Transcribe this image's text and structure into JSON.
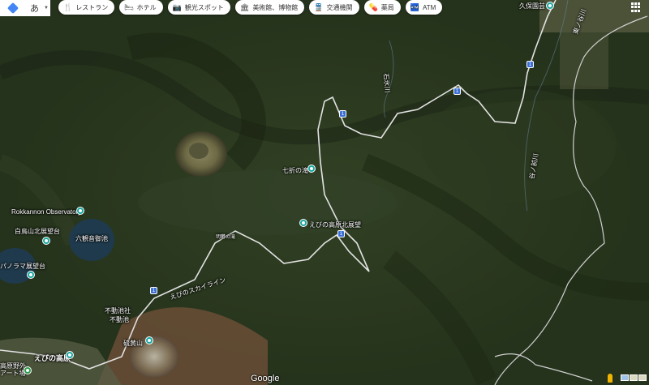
{
  "colors": {
    "terrain_dark": "#1f2a18",
    "forest": "#2e3d22",
    "lake": "#1f3a4c",
    "road": "#e8e8e8",
    "pin": "#1aa7a0",
    "route_shield": "#3b6fd6",
    "accent_blue": "#4285f4"
  },
  "topbar": {
    "language": "あ",
    "chips": [
      {
        "icon": "fork-knife-icon",
        "glyph": "🍴",
        "label": "レストラン"
      },
      {
        "icon": "bed-icon",
        "glyph": "🛏",
        "label": "ホテル"
      },
      {
        "icon": "camera-icon",
        "glyph": "📷",
        "label": "観光スポット"
      },
      {
        "icon": "museum-icon",
        "glyph": "🏛",
        "label": "美術館、博物館"
      },
      {
        "icon": "train-icon",
        "glyph": "🚆",
        "label": "交通機関"
      },
      {
        "icon": "pharmacy-icon",
        "glyph": "💊",
        "label": "薬局"
      },
      {
        "icon": "atm-icon",
        "glyph": "🏧",
        "label": "ATM"
      }
    ]
  },
  "places": {
    "kubo": "久保園芸",
    "nanaori": "七折の滝",
    "ebino_north": "えびの高原北展望",
    "rokkannon_obs": "Rokkannon Observatory",
    "shiratori": "白鳥山北展望台",
    "rokkannon_pond": "六観音御池",
    "panorama": "パノラマ展望台",
    "meikan": "明礬の滝",
    "skyline": "えびのスカイライン",
    "fudo_shrine": "不動池社",
    "fudo_pond": "不動池",
    "iozan": "硫黄山",
    "ebino_kogen": "えびの高原",
    "camp": "高原野外\nアート場"
  },
  "rivers": {
    "ishizawa": "石氷川",
    "higashi": "東ノ谷川",
    "tani": "谷ノ前川"
  },
  "route_number": "1",
  "footer": {
    "brand": "Google"
  }
}
